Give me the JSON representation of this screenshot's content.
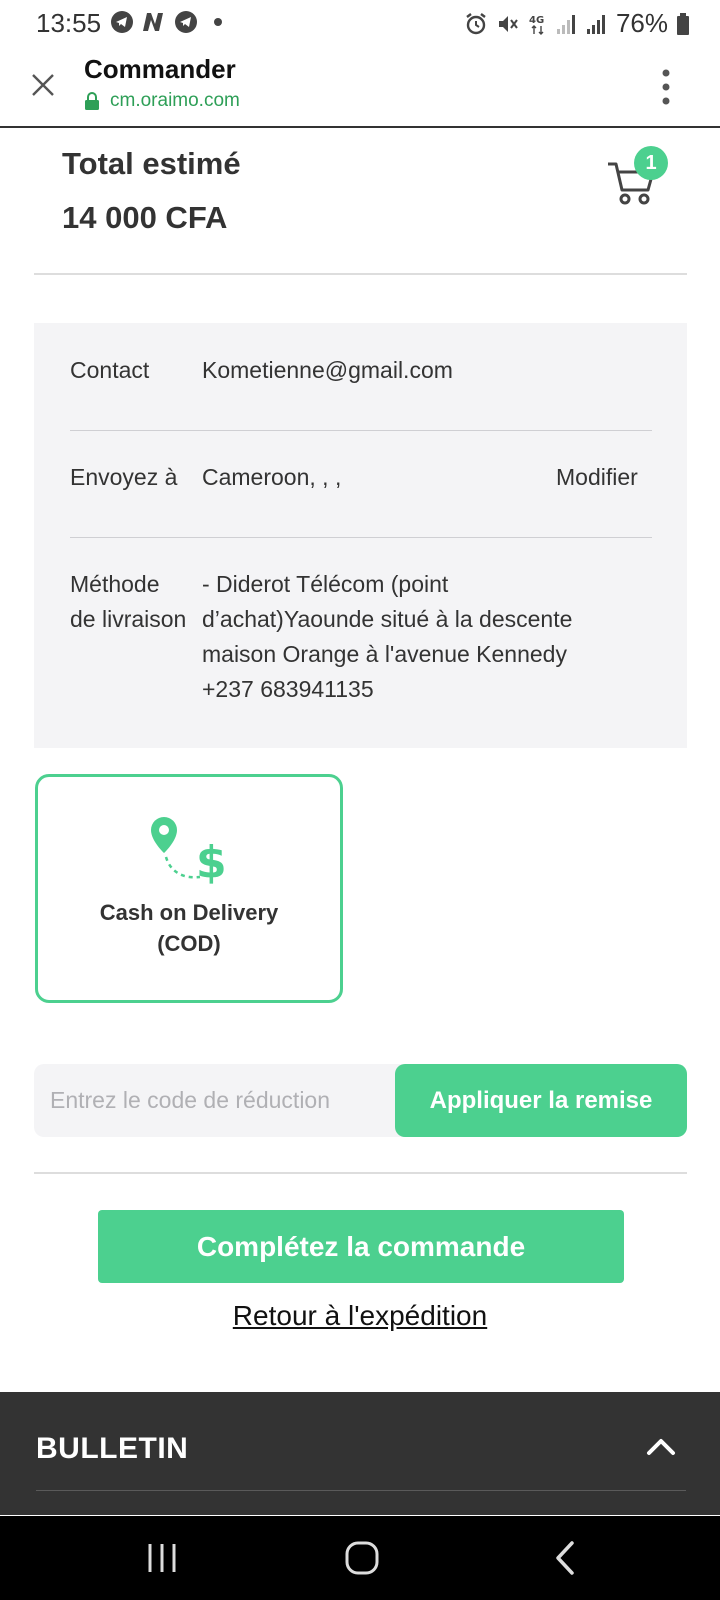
{
  "status_bar": {
    "time": "13:55",
    "battery": "76%",
    "icons": [
      "telegram-icon",
      "n-app-icon",
      "telegram-icon",
      "alarm-icon",
      "mute-icon",
      "4g-icon",
      "signal-icon",
      "signal-icon",
      "battery-icon"
    ]
  },
  "browser": {
    "title": "Commander",
    "url": "cm.oraimo.com"
  },
  "summary": {
    "total_label": "Total estimé",
    "total_value": "14 000 CFA",
    "cart_count": "1"
  },
  "info": {
    "contact_label": "Contact",
    "contact_value": "Kometienne@gmail.com",
    "ship_label": "Envoyez à",
    "ship_value": "Cameroon, , ,",
    "ship_edit": "Modifier",
    "method_label_1": "Méthode",
    "method_label_2": "de livraison",
    "method_line_1": "- Diderot Télécom (point",
    "method_line_2": "d’achat)Yaounde situé à la descente",
    "method_line_3": "maison Orange à l'avenue Kennedy",
    "method_line_4": "+237 683941135"
  },
  "payment": {
    "label_1": "Cash on Delivery",
    "label_2": "(COD)",
    "accent": "#4cd08f"
  },
  "discount": {
    "placeholder": "Entrez le code de réduction",
    "apply_label": "Appliquer la remise"
  },
  "actions": {
    "complete_label": "Complétez la commande",
    "back_label": "Retour à l'expédition"
  },
  "footer": {
    "title": "BULLETIN"
  }
}
